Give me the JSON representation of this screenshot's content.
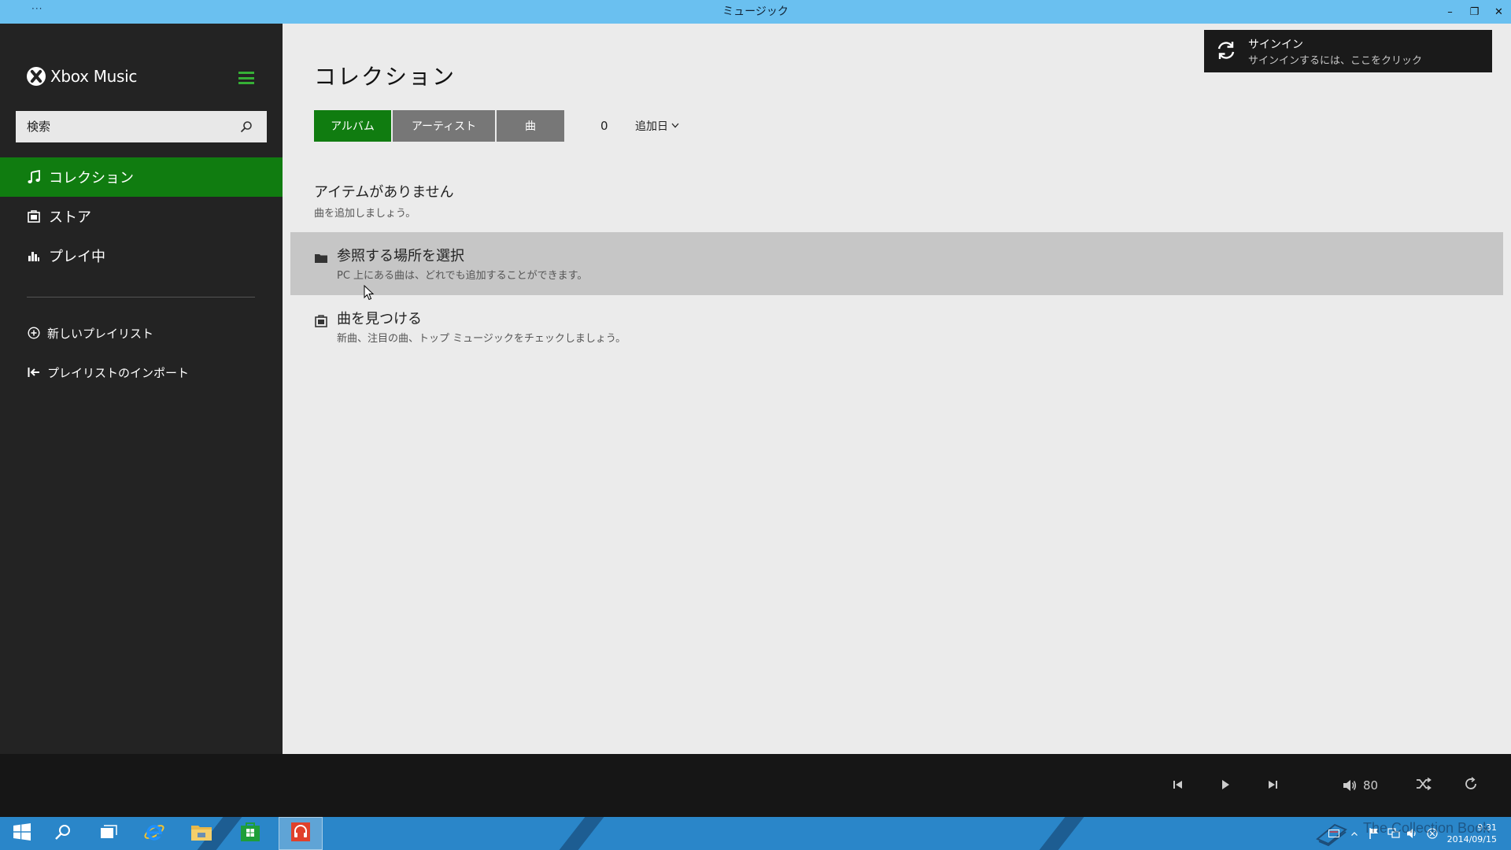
{
  "window": {
    "title": "ミュージック",
    "menu_dots": "···",
    "minimize_glyph": "–",
    "maximize_glyph": "❐",
    "close_glyph": "✕"
  },
  "sidebar": {
    "brand": "Xbox Music",
    "search_placeholder": "検索",
    "nav": [
      {
        "label": "コレクション",
        "icon": "music-note-icon"
      },
      {
        "label": "ストア",
        "icon": "store-icon"
      },
      {
        "label": "プレイ中",
        "icon": "equalizer-icon"
      }
    ],
    "playlist_actions": [
      {
        "label": "新しいプレイリスト",
        "icon": "plus-circle-icon"
      },
      {
        "label": "プレイリストのインポート",
        "icon": "import-icon"
      }
    ]
  },
  "main": {
    "title": "コレクション",
    "tabs": [
      {
        "label": "アルバム",
        "active": true
      },
      {
        "label": "アーティスト",
        "active": false
      },
      {
        "label": "曲",
        "active": false
      }
    ],
    "count": "0",
    "sort_label": "追加日",
    "empty_title": "アイテムがありません",
    "empty_subtitle": "曲を追加しましょう。",
    "options": [
      {
        "title": "参照する場所を選択",
        "desc": "PC 上にある曲は、どれでも追加することができます。",
        "icon": "folder-icon",
        "hovered": true
      },
      {
        "title": "曲を見つける",
        "desc": "新曲、注目の曲、トップ ミュージックをチェックしましょう。",
        "icon": "store-icon",
        "hovered": false
      }
    ]
  },
  "signin": {
    "title": "サインイン",
    "subtitle": "サインインするには、ここをクリック",
    "icon": "sync-icon"
  },
  "player": {
    "volume": "80",
    "controls": [
      "previous-icon",
      "play-icon",
      "next-icon",
      "shuffle-icon",
      "repeat-icon"
    ]
  },
  "taskbar": {
    "clock_time": "9:31",
    "clock_date": "2014/09/15",
    "watermark": "The Collection Book"
  },
  "colors": {
    "accent": "#107c10",
    "titlebar": "#6ac0f0",
    "sidebar": "#232323",
    "taskbar": "#2a86c9"
  }
}
